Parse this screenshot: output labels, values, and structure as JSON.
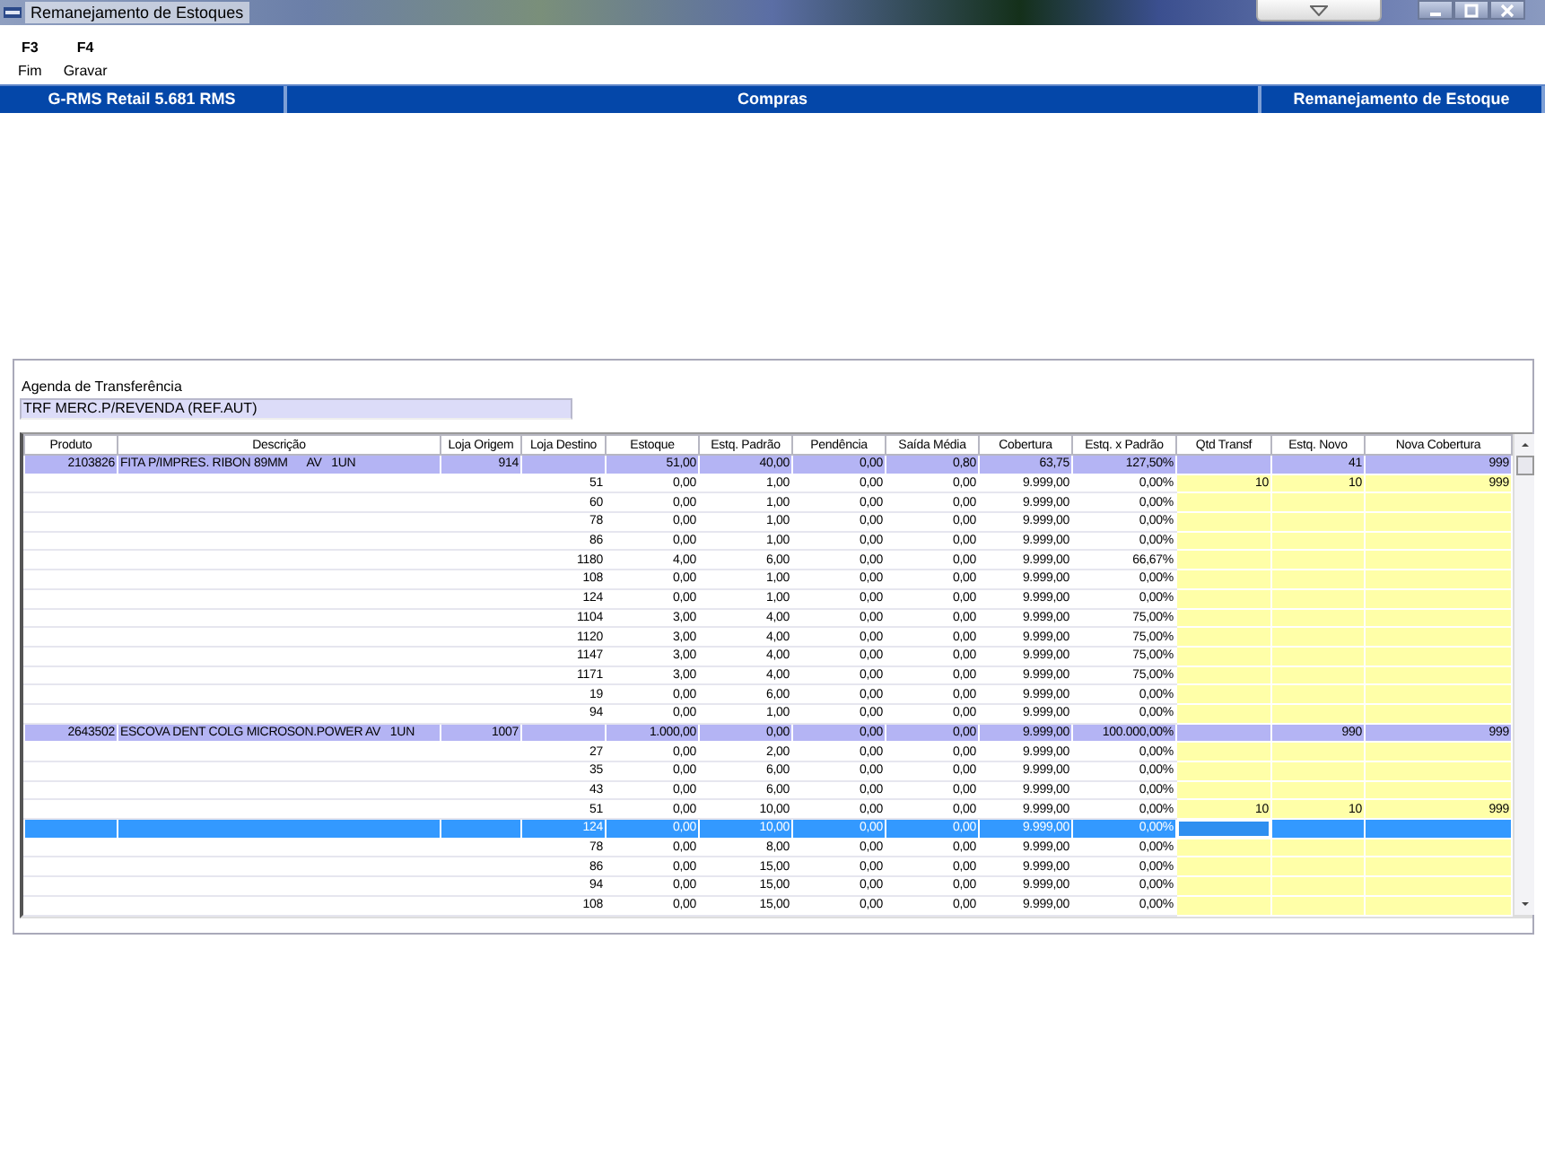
{
  "window": {
    "title": "Remanejamento de Estoques"
  },
  "toolbar": [
    {
      "key": "F3",
      "label": "Fim"
    },
    {
      "key": "F4",
      "label": "Gravar"
    }
  ],
  "header_bar": [
    "G-RMS Retail 5.681 RMS",
    "Compras",
    "Remanejamento de Estoque"
  ],
  "agenda": {
    "label": "Agenda de Transferência",
    "value": "TRF MERC.P/REVENDA (REF.AUT)"
  },
  "table": {
    "columns": [
      "Produto",
      "Descrição",
      "Loja Origem",
      "Loja Destino",
      "Estoque",
      "Estq. Padrão",
      "Pendência",
      "Saída Média",
      "Cobertura",
      "Estq. x Padrão",
      "Qtd Transf",
      "Estq. Novo",
      "Nova Cobertura"
    ],
    "rows": [
      {
        "kind": "product",
        "selected": false,
        "cells": [
          "2103826",
          "FITA P/IMPRES. RIBON 89MM      AV   1UN",
          "914",
          null,
          "51,00",
          "40,00",
          "0,00",
          "0,80",
          "63,75",
          "127,50%",
          null,
          "41",
          "999"
        ]
      },
      {
        "kind": "store",
        "selected": false,
        "cells": [
          null,
          null,
          null,
          "51",
          "0,00",
          "1,00",
          "0,00",
          "0,00",
          "9.999,00",
          "0,00%",
          "10",
          "10",
          "999"
        ]
      },
      {
        "kind": "store",
        "selected": false,
        "cells": [
          null,
          null,
          null,
          "60",
          "0,00",
          "1,00",
          "0,00",
          "0,00",
          "9.999,00",
          "0,00%",
          null,
          null,
          null
        ]
      },
      {
        "kind": "store",
        "selected": false,
        "cells": [
          null,
          null,
          null,
          "78",
          "0,00",
          "1,00",
          "0,00",
          "0,00",
          "9.999,00",
          "0,00%",
          null,
          null,
          null
        ]
      },
      {
        "kind": "store",
        "selected": false,
        "cells": [
          null,
          null,
          null,
          "86",
          "0,00",
          "1,00",
          "0,00",
          "0,00",
          "9.999,00",
          "0,00%",
          null,
          null,
          null
        ]
      },
      {
        "kind": "store",
        "selected": false,
        "cells": [
          null,
          null,
          null,
          "1180",
          "4,00",
          "6,00",
          "0,00",
          "0,00",
          "9.999,00",
          "66,67%",
          null,
          null,
          null
        ]
      },
      {
        "kind": "store",
        "selected": false,
        "cells": [
          null,
          null,
          null,
          "108",
          "0,00",
          "1,00",
          "0,00",
          "0,00",
          "9.999,00",
          "0,00%",
          null,
          null,
          null
        ]
      },
      {
        "kind": "store",
        "selected": false,
        "cells": [
          null,
          null,
          null,
          "124",
          "0,00",
          "1,00",
          "0,00",
          "0,00",
          "9.999,00",
          "0,00%",
          null,
          null,
          null
        ]
      },
      {
        "kind": "store",
        "selected": false,
        "cells": [
          null,
          null,
          null,
          "1104",
          "3,00",
          "4,00",
          "0,00",
          "0,00",
          "9.999,00",
          "75,00%",
          null,
          null,
          null
        ]
      },
      {
        "kind": "store",
        "selected": false,
        "cells": [
          null,
          null,
          null,
          "1120",
          "3,00",
          "4,00",
          "0,00",
          "0,00",
          "9.999,00",
          "75,00%",
          null,
          null,
          null
        ]
      },
      {
        "kind": "store",
        "selected": false,
        "cells": [
          null,
          null,
          null,
          "1147",
          "3,00",
          "4,00",
          "0,00",
          "0,00",
          "9.999,00",
          "75,00%",
          null,
          null,
          null
        ]
      },
      {
        "kind": "store",
        "selected": false,
        "cells": [
          null,
          null,
          null,
          "1171",
          "3,00",
          "4,00",
          "0,00",
          "0,00",
          "9.999,00",
          "75,00%",
          null,
          null,
          null
        ]
      },
      {
        "kind": "store",
        "selected": false,
        "cells": [
          null,
          null,
          null,
          "19",
          "0,00",
          "6,00",
          "0,00",
          "0,00",
          "9.999,00",
          "0,00%",
          null,
          null,
          null
        ]
      },
      {
        "kind": "store",
        "selected": false,
        "cells": [
          null,
          null,
          null,
          "94",
          "0,00",
          "1,00",
          "0,00",
          "0,00",
          "9.999,00",
          "0,00%",
          null,
          null,
          null
        ]
      },
      {
        "kind": "product",
        "selected": false,
        "cells": [
          "2643502",
          "ESCOVA DENT COLG MICROSON.POWER AV   1UN",
          "1007",
          null,
          "1.000,00",
          "0,00",
          "0,00",
          "0,00",
          "9.999,00",
          "100.000,00%",
          null,
          "990",
          "999"
        ]
      },
      {
        "kind": "store",
        "selected": false,
        "cells": [
          null,
          null,
          null,
          "27",
          "0,00",
          "2,00",
          "0,00",
          "0,00",
          "9.999,00",
          "0,00%",
          null,
          null,
          null
        ]
      },
      {
        "kind": "store",
        "selected": false,
        "cells": [
          null,
          null,
          null,
          "35",
          "0,00",
          "6,00",
          "0,00",
          "0,00",
          "9.999,00",
          "0,00%",
          null,
          null,
          null
        ]
      },
      {
        "kind": "store",
        "selected": false,
        "cells": [
          null,
          null,
          null,
          "43",
          "0,00",
          "6,00",
          "0,00",
          "0,00",
          "9.999,00",
          "0,00%",
          null,
          null,
          null
        ]
      },
      {
        "kind": "store",
        "selected": false,
        "cells": [
          null,
          null,
          null,
          "51",
          "0,00",
          "10,00",
          "0,00",
          "0,00",
          "9.999,00",
          "0,00%",
          "10",
          "10",
          "999"
        ]
      },
      {
        "kind": "store",
        "selected": true,
        "editing": true,
        "cells": [
          null,
          null,
          null,
          "124",
          "0,00",
          "10,00",
          "0,00",
          "0,00",
          "9.999,00",
          "0,00%",
          null,
          null,
          null
        ]
      },
      {
        "kind": "store",
        "selected": false,
        "cells": [
          null,
          null,
          null,
          "78",
          "0,00",
          "8,00",
          "0,00",
          "0,00",
          "9.999,00",
          "0,00%",
          null,
          null,
          null
        ]
      },
      {
        "kind": "store",
        "selected": false,
        "cells": [
          null,
          null,
          null,
          "86",
          "0,00",
          "15,00",
          "0,00",
          "0,00",
          "9.999,00",
          "0,00%",
          null,
          null,
          null
        ]
      },
      {
        "kind": "store",
        "selected": false,
        "cells": [
          null,
          null,
          null,
          "94",
          "0,00",
          "15,00",
          "0,00",
          "0,00",
          "9.999,00",
          "0,00%",
          null,
          null,
          null
        ]
      },
      {
        "kind": "store",
        "selected": false,
        "cells": [
          null,
          null,
          null,
          "108",
          "0,00",
          "15,00",
          "0,00",
          "0,00",
          "9.999,00",
          "0,00%",
          null,
          null,
          null
        ]
      }
    ]
  }
}
